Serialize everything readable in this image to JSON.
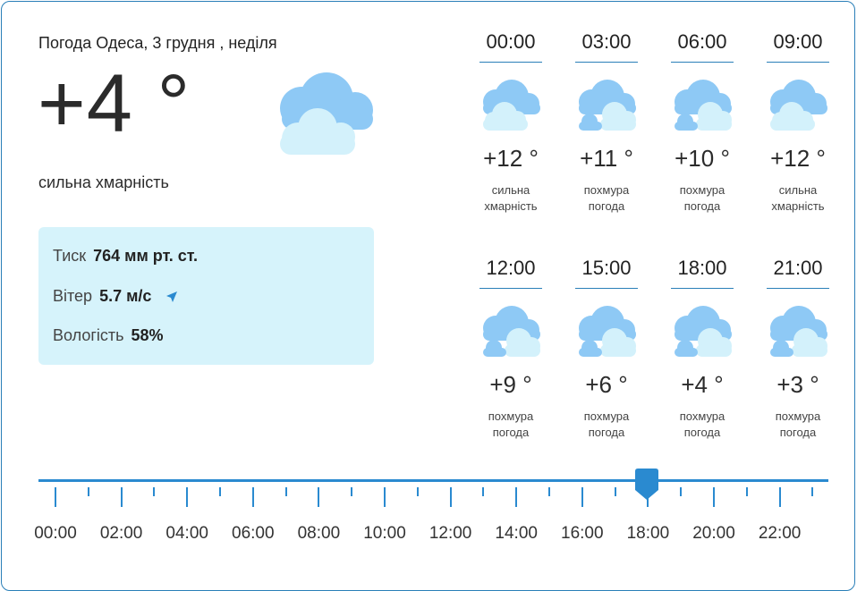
{
  "header": {
    "title": "Погода Одеса, 3 грудня , неділя"
  },
  "current": {
    "temperature": "+4 °",
    "description": "сильна хмарність",
    "icon": "cloudy-icon"
  },
  "details": {
    "pressure_label": "Тиск",
    "pressure_value": "764 мм рт. ст.",
    "wind_label": "Вітер",
    "wind_value": "5.7 м/с",
    "humidity_label": "Вологість",
    "humidity_value": "58%"
  },
  "hourly": [
    {
      "time": "00:00",
      "temp": "+12 °",
      "desc1": "сильна",
      "desc2": "хмарність",
      "icon": "cloudy-icon"
    },
    {
      "time": "03:00",
      "temp": "+11 °",
      "desc1": "похмура",
      "desc2": "погода",
      "icon": "overcast-icon"
    },
    {
      "time": "06:00",
      "temp": "+10 °",
      "desc1": "похмура",
      "desc2": "погода",
      "icon": "overcast-icon"
    },
    {
      "time": "09:00",
      "temp": "+12 °",
      "desc1": "сильна",
      "desc2": "хмарність",
      "icon": "cloudy-icon"
    },
    {
      "time": "12:00",
      "temp": "+9 °",
      "desc1": "похмура",
      "desc2": "погода",
      "icon": "overcast-icon"
    },
    {
      "time": "15:00",
      "temp": "+6 °",
      "desc1": "похмура",
      "desc2": "погода",
      "icon": "overcast-icon"
    },
    {
      "time": "18:00",
      "temp": "+4 °",
      "desc1": "похмура",
      "desc2": "погода",
      "icon": "overcast-icon"
    },
    {
      "time": "21:00",
      "temp": "+3 °",
      "desc1": "похмура",
      "desc2": "погода",
      "icon": "overcast-icon"
    }
  ],
  "timeline": {
    "labels": [
      "00:00",
      "02:00",
      "04:00",
      "06:00",
      "08:00",
      "10:00",
      "12:00",
      "14:00",
      "16:00",
      "18:00",
      "20:00",
      "22:00"
    ],
    "selected": "18:00"
  },
  "colors": {
    "accent": "#2a8ad0",
    "info_bg": "#d6f3fb",
    "cloud_dark": "#8ec9f5",
    "cloud_light": "#d3f1fb"
  }
}
